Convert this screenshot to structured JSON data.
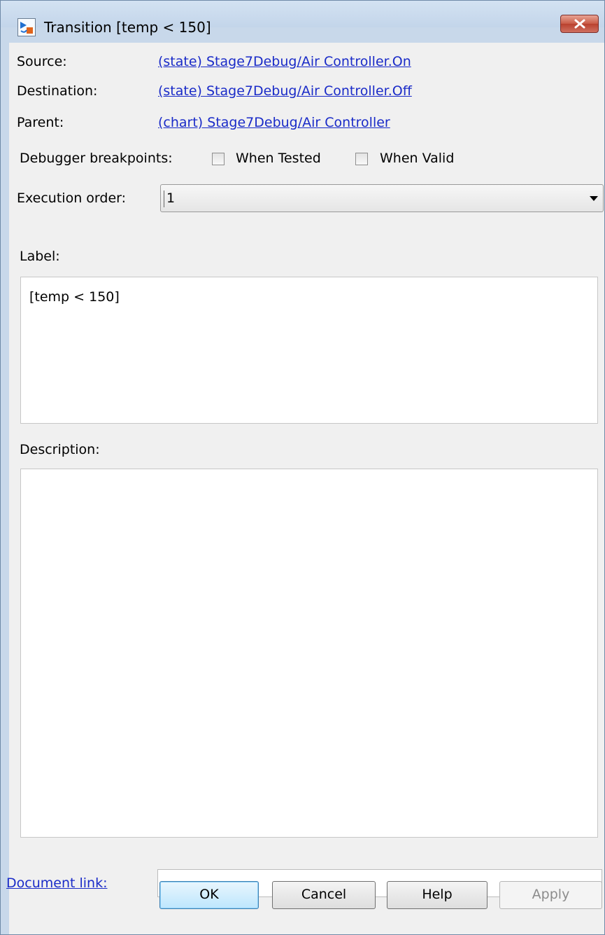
{
  "window": {
    "title": "Transition [temp < 150]"
  },
  "info": {
    "source_label": "Source:",
    "source_link": "(state) Stage7Debug/Air Controller.On",
    "destination_label": "Destination:",
    "destination_link": "(state) Stage7Debug/Air Controller.Off",
    "parent_label": "Parent:",
    "parent_link": "(chart) Stage7Debug/Air Controller"
  },
  "breakpoints": {
    "label": "Debugger breakpoints:",
    "when_tested": {
      "label": "When Tested",
      "checked": false
    },
    "when_valid": {
      "label": "When Valid",
      "checked": false
    }
  },
  "execution": {
    "label": "Execution order:",
    "value": "1"
  },
  "label_section": {
    "heading": "Label:",
    "value": "[temp < 150]"
  },
  "description_section": {
    "heading": "Description:",
    "value": ""
  },
  "document": {
    "link_label": "Document link:",
    "value": ""
  },
  "buttons": {
    "ok": "OK",
    "cancel": "Cancel",
    "help": "Help",
    "apply": "Apply"
  }
}
